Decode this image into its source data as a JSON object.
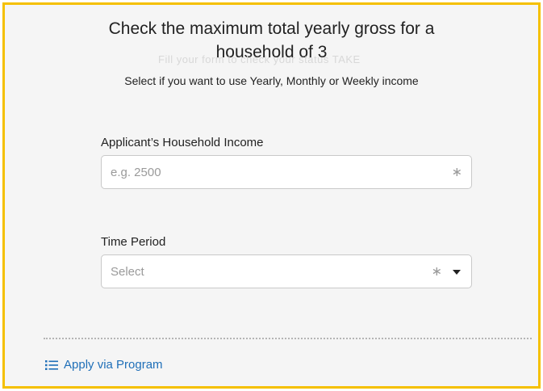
{
  "form": {
    "title_line1": "Check the maximum total yearly gross for a",
    "title_line2": "household of 3",
    "ghost_text": "Fill your form to check your status TAKE",
    "subtitle": "Select if you want to use Yearly, Monthly or Weekly income",
    "income": {
      "label": "Applicant’s Household Income",
      "placeholder": "e.g. 2500",
      "value": "",
      "required_mark": "∗"
    },
    "time_period": {
      "label": "Time Period",
      "selected": "Select",
      "required_mark": "∗",
      "caret_icon": "caret-down-icon"
    }
  },
  "footer": {
    "apply_link": "Apply via Program",
    "apply_icon": "list-icon"
  },
  "colors": {
    "border_accent": "#f5c000",
    "link": "#1f6fb8",
    "panel_bg": "#f5f5f5"
  }
}
